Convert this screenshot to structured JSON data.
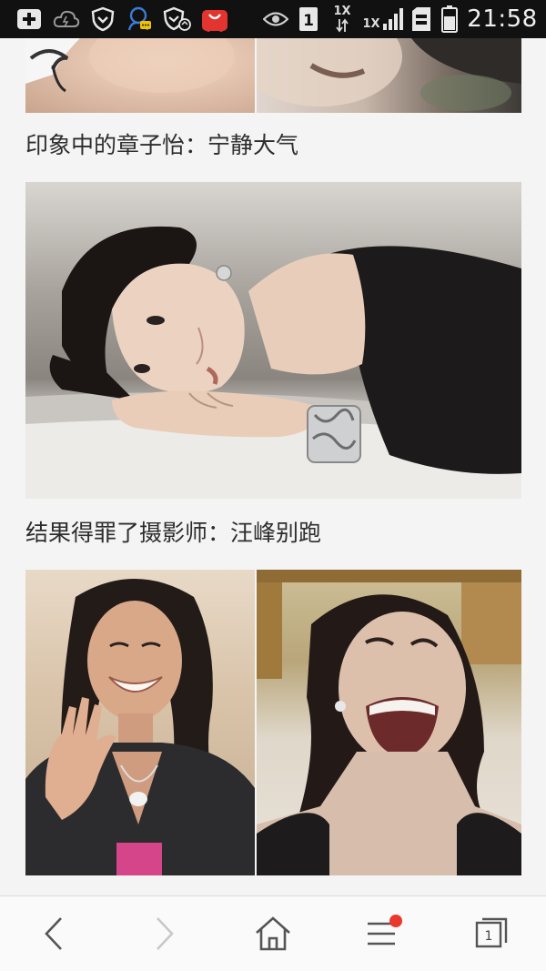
{
  "status_bar": {
    "time": "21:58",
    "sim_indicator": "1",
    "net_speed_top": "1X",
    "net_speed_bottom": "1X",
    "icons": [
      "add-box-icon",
      "cloud-icon",
      "shield-icon",
      "chat-bubble-icon",
      "shield-sync-icon",
      "shopping-bag-icon",
      "eye-icon",
      "sim-icon",
      "data-arrows-icon",
      "signal-icon",
      "sd-card-icon",
      "battery-icon"
    ]
  },
  "article": {
    "captions": [
      "印象中的章子怡：宁静大气",
      "结果得罪了摄影师：汪峰别跑"
    ]
  },
  "bottom_nav": {
    "tab_count": "1",
    "menu_badge_color": "#e8392c",
    "icons": [
      "back-arrow-icon",
      "forward-arrow-icon",
      "home-icon",
      "menu-icon",
      "tabs-icon"
    ]
  },
  "colors": {
    "status_bar_bg": "#111111",
    "page_bg": "#f4f4f4",
    "nav_bg": "#fafafa",
    "caption_text": "#2d2d2d"
  }
}
